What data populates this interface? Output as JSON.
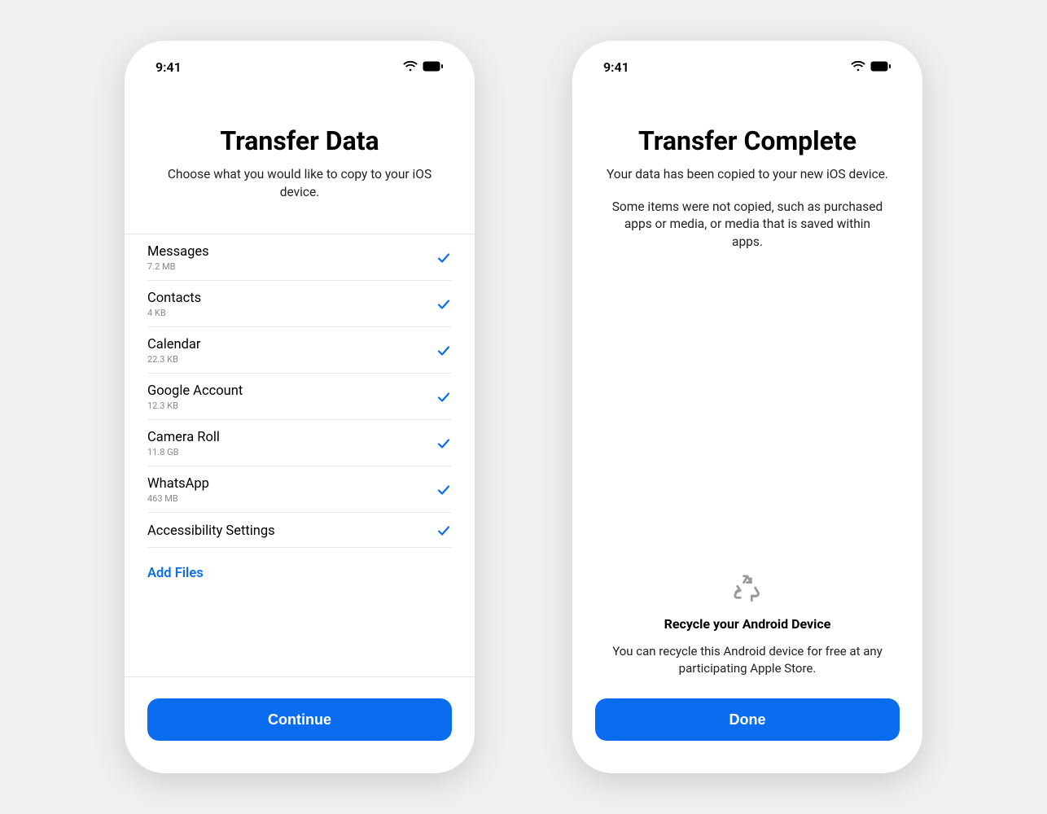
{
  "status": {
    "time": "9:41"
  },
  "screen1": {
    "title": "Transfer Data",
    "subtitle": "Choose what you would like to copy to your iOS device.",
    "items": [
      {
        "label": "Messages",
        "size": "7.2 MB"
      },
      {
        "label": "Contacts",
        "size": "4 KB"
      },
      {
        "label": "Calendar",
        "size": "22.3 KB"
      },
      {
        "label": "Google Account",
        "size": "12.3 KB"
      },
      {
        "label": "Camera Roll",
        "size": "11.8 GB"
      },
      {
        "label": "WhatsApp",
        "size": "463 MB"
      },
      {
        "label": "Accessibility Settings",
        "size": ""
      }
    ],
    "add_files": "Add Files",
    "continue": "Continue"
  },
  "screen2": {
    "title": "Transfer Complete",
    "subtitle": "Your data has been copied to your new iOS device.",
    "note": "Some items were not copied, such as purchased apps or media, or media that is saved within apps.",
    "recycle_title": "Recycle your Android Device",
    "recycle_text": "You can recycle this Android device for free at any participating Apple Store.",
    "done": "Done"
  },
  "colors": {
    "accent": "#0a6df0"
  }
}
